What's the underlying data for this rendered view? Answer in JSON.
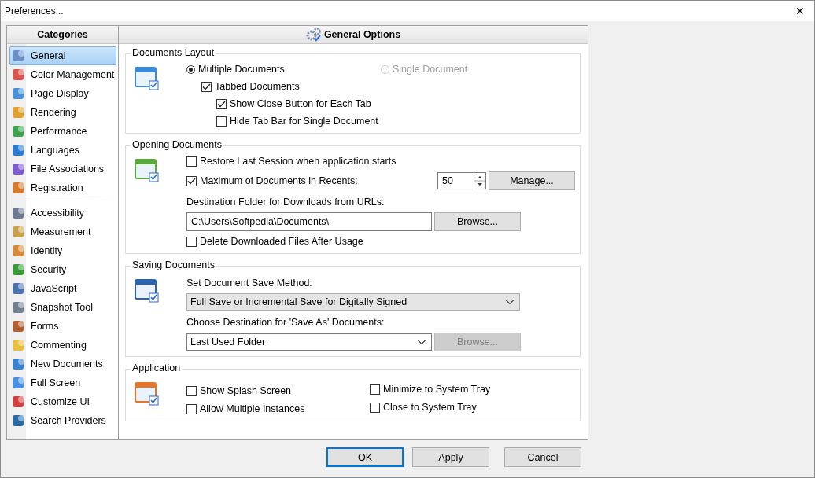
{
  "window": {
    "title": "Preferences...",
    "close": "✕"
  },
  "sidebar": {
    "heading": "Categories",
    "groups": [
      {
        "items": [
          {
            "label": "General",
            "selected": true
          },
          {
            "label": "Color Management",
            "selected": false
          },
          {
            "label": "Page Display",
            "selected": false
          },
          {
            "label": "Rendering",
            "selected": false
          },
          {
            "label": "Performance",
            "selected": false
          },
          {
            "label": "Languages",
            "selected": false
          },
          {
            "label": "File Associations",
            "selected": false
          },
          {
            "label": "Registration",
            "selected": false
          }
        ]
      },
      {
        "items": [
          {
            "label": "Accessibility",
            "selected": false
          },
          {
            "label": "Measurement",
            "selected": false
          },
          {
            "label": "Identity",
            "selected": false
          },
          {
            "label": "Security",
            "selected": false
          },
          {
            "label": "JavaScript",
            "selected": false
          },
          {
            "label": "Snapshot Tool",
            "selected": false
          },
          {
            "label": "Forms",
            "selected": false
          },
          {
            "label": "Commenting",
            "selected": false
          },
          {
            "label": "New Documents",
            "selected": false
          },
          {
            "label": "Full Screen",
            "selected": false
          },
          {
            "label": "Customize UI",
            "selected": false
          },
          {
            "label": "Search Providers",
            "selected": false
          }
        ]
      }
    ]
  },
  "content": {
    "heading": "General Options",
    "sections": [
      {
        "title": "Documents Layout",
        "rows": [
          {
            "kind": "radios",
            "options": [
              {
                "label": "Multiple Documents",
                "selected": true,
                "disabled": false,
                "children": [
                  {
                    "label": "Tabbed Documents",
                    "checked": true,
                    "children": [
                      {
                        "label": "Show Close Button for Each Tab",
                        "checked": true
                      },
                      {
                        "label": "Hide Tab Bar for Single Document",
                        "checked": false
                      }
                    ]
                  }
                ]
              },
              {
                "label": "Single Document",
                "selected": false,
                "disabled": true
              }
            ]
          }
        ]
      },
      {
        "title": "Opening Documents",
        "rows": [
          {
            "kind": "checkbox",
            "label": "Restore Last Session when application starts",
            "checked": false
          },
          {
            "kind": "spin-checkbox",
            "label": "Maximum of Documents in Recents:",
            "checked": true,
            "value": "50",
            "button": {
              "label": "Manage...",
              "disabled": false
            }
          },
          {
            "kind": "label",
            "text": "Destination Folder for Downloads from URLs:"
          },
          {
            "kind": "path-field",
            "value": "C:\\Users\\Softpedia\\Documents\\",
            "button": {
              "label": "Browse...",
              "disabled": false
            }
          },
          {
            "kind": "checkbox",
            "label": "Delete Downloaded Files After Usage",
            "checked": false
          }
        ]
      },
      {
        "title": "Saving Documents",
        "rows": [
          {
            "kind": "label",
            "text": "Set Document Save Method:"
          },
          {
            "kind": "dropdown",
            "value": "Full Save or Incremental Save for Digitally Signed"
          },
          {
            "kind": "label",
            "text": "Choose Destination for 'Save As' Documents:"
          },
          {
            "kind": "dropdown",
            "value": "Last Used Folder",
            "button": {
              "label": "Browse...",
              "disabled": true
            }
          }
        ]
      },
      {
        "title": "Application",
        "rows": [
          {
            "kind": "checkbox-columns",
            "columns": [
              [
                {
                  "label": "Show Splash Screen",
                  "checked": false
                },
                {
                  "label": "Allow Multiple Instances",
                  "checked": false
                }
              ],
              [
                {
                  "label": "Minimize to System Tray",
                  "checked": false
                },
                {
                  "label": "Close to System Tray",
                  "checked": false
                }
              ]
            ]
          }
        ]
      }
    ]
  },
  "buttons": [
    {
      "label": "OK",
      "default": true
    },
    {
      "label": "Apply",
      "default": false
    },
    {
      "label": "Cancel",
      "default": false
    }
  ]
}
